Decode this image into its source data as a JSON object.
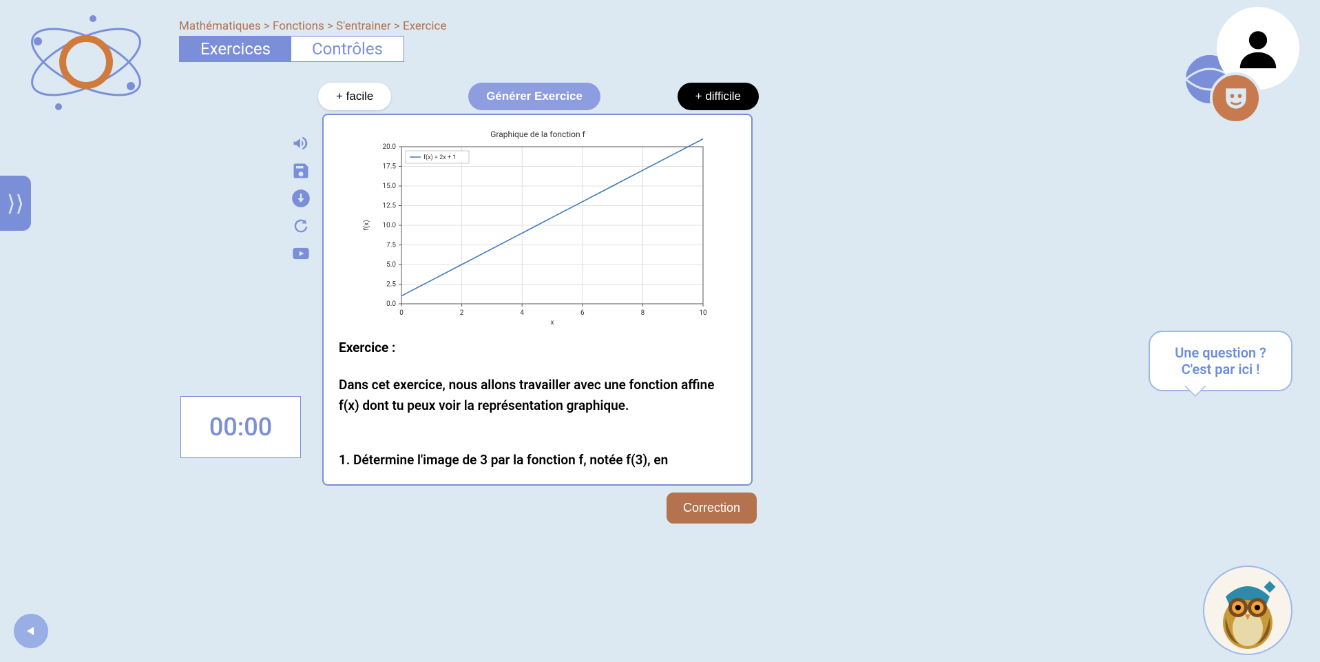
{
  "breadcrumb": {
    "course": "Mathématiques",
    "topic": "Fonctions",
    "section": "S'entrainer",
    "page": "Exercice",
    "sep": " > "
  },
  "tabs": {
    "exercises": "Exercices",
    "controls": "Contrôles"
  },
  "difficulty": {
    "easier": "+ facile",
    "generate": "Générer Exercice",
    "harder": "+ difficile"
  },
  "timer": {
    "value": "00:00"
  },
  "correction_label": "Correction",
  "help": {
    "line1": "Une question ?",
    "line2": "C'est par ici !"
  },
  "exercise": {
    "heading": "Exercice :",
    "intro": "Dans cet exercice, nous allons travailler avec une fonction affine f(x) dont tu peux voir la représentation graphique.",
    "q1": "1. Détermine l'image de 3 par la fonction f, notée f(3), en"
  },
  "chart_data": {
    "type": "line",
    "title": "Graphique de la fonction f",
    "xlabel": "x",
    "ylabel": "f(x)",
    "xlim": [
      0,
      10
    ],
    "ylim": [
      0,
      20
    ],
    "xticks": [
      0,
      2,
      4,
      6,
      8,
      10
    ],
    "yticks": [
      0.0,
      2.5,
      5.0,
      7.5,
      10.0,
      12.5,
      15.0,
      17.5,
      20.0
    ],
    "grid": true,
    "legend": {
      "position": "top-left",
      "entries": [
        "f(x) = 2x + 1"
      ]
    },
    "series": [
      {
        "name": "f(x) = 2x + 1",
        "x": [
          0,
          1,
          2,
          3,
          4,
          5,
          6,
          7,
          8,
          9,
          10
        ],
        "y": [
          1,
          3,
          5,
          7,
          9,
          11,
          13,
          15,
          17,
          19,
          21
        ],
        "color": "#3e7bbf"
      }
    ]
  }
}
